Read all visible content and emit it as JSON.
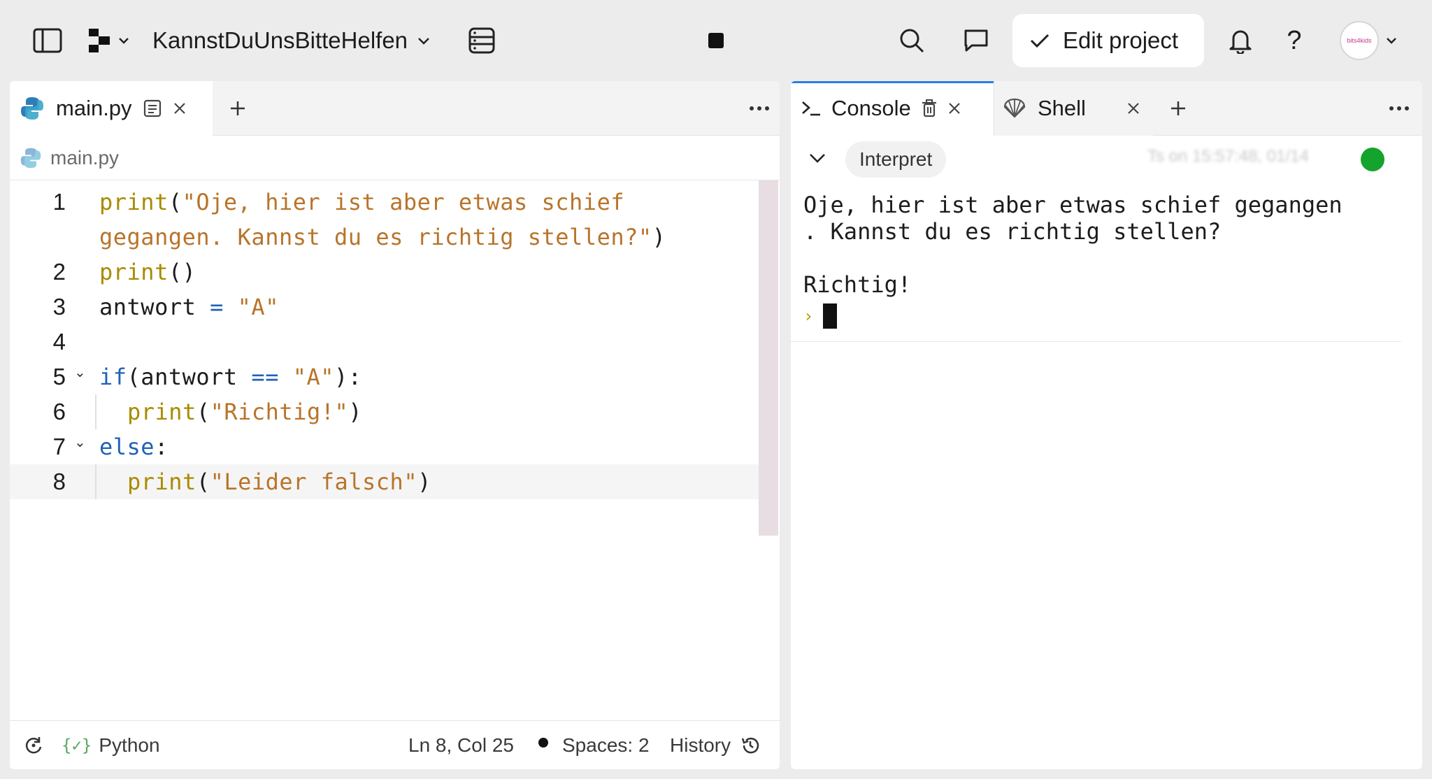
{
  "topbar": {
    "project_name": "KannstDuUnsBitteHelfen",
    "edit_project_label": "Edit project",
    "help_label": "?",
    "avatar_text": "bits4kids"
  },
  "editor": {
    "tab": {
      "label": "main.py"
    },
    "breadcrumb": "main.py",
    "lines": [
      {
        "num": "1",
        "tokens": [
          {
            "c": "kw-fn",
            "t": "print"
          },
          {
            "c": "punc",
            "t": "("
          },
          {
            "c": "str",
            "t": "\"Oje, hier ist aber etwas schief"
          }
        ]
      },
      {
        "num": "",
        "tokens": [
          {
            "c": "str",
            "t": "gegangen. Kannst du es richtig stellen?\""
          },
          {
            "c": "punc",
            "t": ")"
          }
        ]
      },
      {
        "num": "2",
        "tokens": [
          {
            "c": "kw-fn",
            "t": "print"
          },
          {
            "c": "punc",
            "t": "()"
          }
        ]
      },
      {
        "num": "3",
        "tokens": [
          {
            "c": "punc",
            "t": "antwort "
          },
          {
            "c": "op",
            "t": "="
          },
          {
            "c": "punc",
            "t": " "
          },
          {
            "c": "str",
            "t": "\"A\""
          }
        ]
      },
      {
        "num": "4",
        "tokens": []
      },
      {
        "num": "5",
        "fold": true,
        "tokens": [
          {
            "c": "kw-ctl",
            "t": "if"
          },
          {
            "c": "punc",
            "t": "(antwort "
          },
          {
            "c": "op",
            "t": "=="
          },
          {
            "c": "punc",
            "t": " "
          },
          {
            "c": "str",
            "t": "\"A\""
          },
          {
            "c": "punc",
            "t": "):"
          }
        ]
      },
      {
        "num": "6",
        "indent": true,
        "tokens": [
          {
            "c": "kw-fn",
            "t": "print"
          },
          {
            "c": "punc",
            "t": "("
          },
          {
            "c": "str",
            "t": "\"Richtig!\""
          },
          {
            "c": "punc",
            "t": ")"
          }
        ]
      },
      {
        "num": "7",
        "fold": true,
        "tokens": [
          {
            "c": "kw-ctl",
            "t": "else"
          },
          {
            "c": "punc",
            "t": ":"
          }
        ]
      },
      {
        "num": "8",
        "indent": true,
        "current": true,
        "tokens": [
          {
            "c": "kw-fn",
            "t": "print"
          },
          {
            "c": "punc",
            "t": "("
          },
          {
            "c": "str",
            "t": "\"Leider falsch\""
          },
          {
            "c": "punc",
            "t": ")"
          }
        ]
      }
    ],
    "status": {
      "language": "Python",
      "position": "Ln 8, Col 25",
      "spaces": "Spaces: 2",
      "history": "History"
    }
  },
  "console": {
    "tabs": [
      {
        "label": "Console"
      },
      {
        "label": "Shell"
      }
    ],
    "interpret_label": "Interpret",
    "timestamp": "Ts on 15:57:48, 01/14",
    "output": "Oje, hier ist aber etwas schief gegangen\n. Kannst du es richtig stellen?\n\nRichtig!",
    "prompt": "›"
  },
  "colors": {
    "accent": "#2b7de9",
    "status_ok": "#14a32c",
    "function": "#a88b00",
    "string": "#b8742a",
    "keyword": "#1f62b8"
  }
}
